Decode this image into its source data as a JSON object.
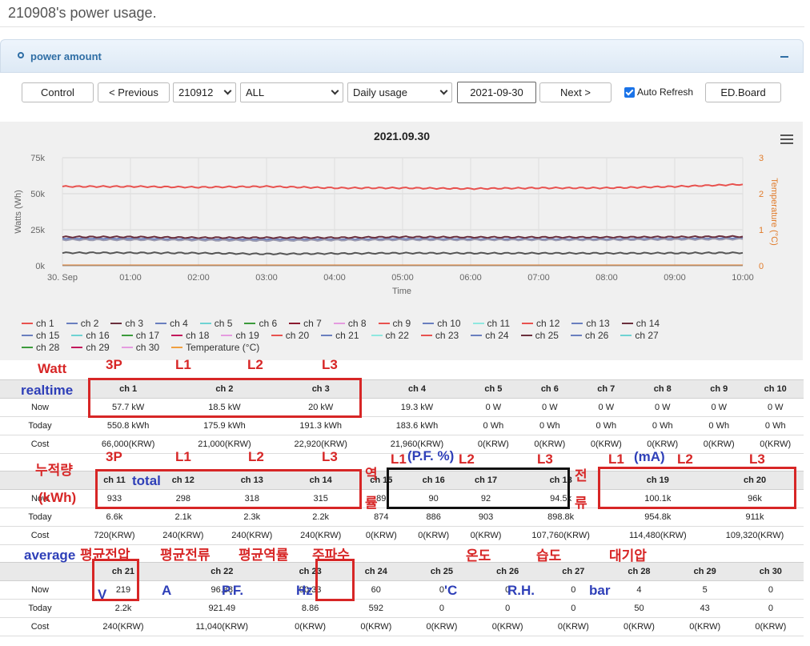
{
  "page": {
    "title": "210908's power usage."
  },
  "panel": {
    "title": "power amount"
  },
  "toolbar": {
    "control": "Control",
    "previous": "< Previous",
    "device": "210912",
    "channel": "ALL",
    "mode": "Daily usage",
    "date": "2021-09-30",
    "next": "Next >",
    "auto_refresh": "Auto Refresh",
    "edboard": "ED.Board"
  },
  "chart_data": {
    "type": "line",
    "title": "2021.09.30",
    "xlabel": "Time",
    "ylabel": "Watts (Wh)",
    "y2label": "Temperature (°C)",
    "x_ticks": [
      "30. Sep",
      "01:00",
      "02:00",
      "03:00",
      "04:00",
      "05:00",
      "06:00",
      "07:00",
      "08:00",
      "09:00",
      "10:00"
    ],
    "y_ticks": [
      "0k",
      "25k",
      "50k",
      "75k"
    ],
    "y2_ticks": [
      "0",
      "1",
      "2",
      "3"
    ],
    "ylim": [
      0,
      75000
    ],
    "y2lim": [
      0,
      3
    ],
    "grid": true,
    "series": [
      {
        "name": "ch 1",
        "color": "#e8524f",
        "values": [
          55000,
          55000,
          54500,
          55000,
          54000,
          54000,
          53500,
          54000,
          54000,
          55000,
          56500
        ]
      },
      {
        "name": "ch 2",
        "color": "#6a7fbf",
        "values": [
          19000,
          19000,
          18500,
          18500,
          18500,
          18800,
          18700,
          18600,
          18600,
          19000,
          19300
        ]
      },
      {
        "name": "ch 3",
        "color": "#6b2f3d",
        "values": [
          20000,
          20000,
          19500,
          19500,
          19500,
          20000,
          19800,
          19800,
          19800,
          20000,
          20300
        ]
      },
      {
        "name": "ch 4",
        "color": "#9a9ab0",
        "values": [
          18000,
          18000,
          17800,
          17500,
          17800,
          18000,
          18000,
          18000,
          18000,
          18300,
          18500
        ]
      },
      {
        "name": "ch 14",
        "color": "#555555",
        "values": [
          9000,
          9000,
          8800,
          8200,
          8500,
          8800,
          8700,
          8700,
          8700,
          8800,
          9000
        ]
      }
    ],
    "legend_position": "bottom"
  },
  "legend": {
    "rows": [
      [
        {
          "name": "ch 1",
          "color": "#e8524f"
        },
        {
          "name": "ch 2",
          "color": "#6a7fbf"
        },
        {
          "name": "ch 3",
          "color": "#6b2f3d"
        },
        {
          "name": "ch 4",
          "color": "#6a7fbf"
        },
        {
          "name": "ch 5",
          "color": "#6ed3d3"
        },
        {
          "name": "ch 6",
          "color": "#3b9a3b"
        },
        {
          "name": "ch 7",
          "color": "#8b1a2f"
        },
        {
          "name": "ch 8",
          "color": "#e59be0"
        },
        {
          "name": "ch 9",
          "color": "#e8524f"
        },
        {
          "name": "ch 10",
          "color": "#6a7fbf"
        },
        {
          "name": "ch 11",
          "color": "#8fe8e0"
        },
        {
          "name": "ch 12",
          "color": "#e8524f"
        },
        {
          "name": "ch 13",
          "color": "#6a7fbf"
        },
        {
          "name": "ch 14",
          "color": "#6b2f3d"
        }
      ],
      [
        {
          "name": "ch 15",
          "color": "#6a7fbf"
        },
        {
          "name": "ch 16",
          "color": "#6ed3d3"
        },
        {
          "name": "ch 17",
          "color": "#3b9a3b"
        },
        {
          "name": "ch 18",
          "color": "#c2185b"
        },
        {
          "name": "ch 19",
          "color": "#e59be0"
        },
        {
          "name": "ch 20",
          "color": "#e8524f"
        },
        {
          "name": "ch 21",
          "color": "#6a7fbf"
        },
        {
          "name": "ch 22",
          "color": "#8fe8e0"
        },
        {
          "name": "ch 23",
          "color": "#e8524f"
        },
        {
          "name": "ch 24",
          "color": "#6a7fbf"
        },
        {
          "name": "ch 25",
          "color": "#6b2f3d"
        },
        {
          "name": "ch 26",
          "color": "#6a7fbf"
        },
        {
          "name": "ch 27",
          "color": "#6ed3d3"
        }
      ],
      [
        {
          "name": "ch 28",
          "color": "#3b9a3b"
        },
        {
          "name": "ch 29",
          "color": "#c2185b"
        },
        {
          "name": "ch 30",
          "color": "#e59be0"
        },
        {
          "name": "Temperature (°C)",
          "color": "#f0a040"
        }
      ]
    ]
  },
  "tables": [
    {
      "headers": [
        "ch 1",
        "ch 2",
        "ch 3",
        "ch 4",
        "ch 5",
        "ch 6",
        "ch 7",
        "ch 8",
        "ch 9",
        "ch 10"
      ],
      "rows": [
        {
          "label": "Now",
          "cells": [
            "57.7 kW",
            "18.5 kW",
            "20 kW",
            "19.3 kW",
            "0 W",
            "0 W",
            "0 W",
            "0 W",
            "0 W",
            "0 W"
          ]
        },
        {
          "label": "Today",
          "cells": [
            "550.8 kWh",
            "175.9 kWh",
            "191.3 kWh",
            "183.6 kWh",
            "0 Wh",
            "0 Wh",
            "0 Wh",
            "0 Wh",
            "0 Wh",
            "0 Wh"
          ]
        },
        {
          "label": "Cost",
          "cells": [
            "66,000(KRW)",
            "21,000(KRW)",
            "22,920(KRW)",
            "21,960(KRW)",
            "0(KRW)",
            "0(KRW)",
            "0(KRW)",
            "0(KRW)",
            "0(KRW)",
            "0(KRW)"
          ]
        }
      ]
    },
    {
      "headers": [
        "ch 11",
        "ch 12",
        "ch 13",
        "ch 14",
        "ch 15",
        "ch 16",
        "ch 17",
        "ch 18",
        "ch 19",
        "ch 20"
      ],
      "rows": [
        {
          "label": "Now",
          "cells": [
            "933",
            "298",
            "318",
            "315",
            "89",
            "90",
            "92",
            "94.5k",
            "100.1k",
            "96k"
          ]
        },
        {
          "label": "Today",
          "cells": [
            "6.6k",
            "2.1k",
            "2.3k",
            "2.2k",
            "874",
            "886",
            "903",
            "898.8k",
            "954.8k",
            "911k"
          ]
        },
        {
          "label": "Cost",
          "cells": [
            "720(KRW)",
            "240(KRW)",
            "240(KRW)",
            "240(KRW)",
            "0(KRW)",
            "0(KRW)",
            "0(KRW)",
            "107,760(KRW)",
            "114,480(KRW)",
            "109,320(KRW)"
          ]
        }
      ]
    },
    {
      "headers": [
        "ch 21",
        "ch 22",
        "ch 23",
        "ch 24",
        "ch 25",
        "ch 26",
        "ch 27",
        "ch 28",
        "ch 29",
        "ch 30"
      ],
      "rows": [
        {
          "label": "Now",
          "cells": [
            "219",
            "96.88",
            "90.33",
            "60",
            "0",
            "0",
            "0",
            "4",
            "5",
            "0"
          ]
        },
        {
          "label": "Today",
          "cells": [
            "2.2k",
            "921.49",
            "8.86",
            "592",
            "0",
            "0",
            "0",
            "50",
            "43",
            "0"
          ]
        },
        {
          "label": "Cost",
          "cells": [
            "240(KRW)",
            "11,040(KRW)",
            "0(KRW)",
            "0(KRW)",
            "0(KRW)",
            "0(KRW)",
            "0(KRW)",
            "0(KRW)",
            "0(KRW)",
            "0(KRW)"
          ]
        }
      ]
    }
  ],
  "annotations": {
    "watt": "Watt",
    "realtime": "realtime",
    "p3_a": "3P",
    "l1_a": "L1",
    "l2_a": "L2",
    "l3_a": "L3",
    "cumulative": "누적량",
    "kwh": "(kWh)",
    "p3_b": "3P",
    "total": "total",
    "l1_b": "L1",
    "l2_b": "L2",
    "l3_b": "L3",
    "pf_label1": "역",
    "pf_label2": "률",
    "l1_c": "L1",
    "pf_pct": "(P.F. %)",
    "l2_c": "L2",
    "l3_c": "L3",
    "cur_label1": "전",
    "cur_label2": "류",
    "l1_d": "L1",
    "ma": "(mA)",
    "l2_d": "L2",
    "l3_d": "L3",
    "average": "average",
    "avg_voltage": "평균전압",
    "avg_current": "평균전류",
    "avg_pf": "평균역률",
    "frequency": "주파수",
    "temperature": "온도",
    "humidity": "습도",
    "pressure": "대기압",
    "v": "V",
    "a": "A",
    "pf": "P.F.",
    "hz": "Hz",
    "degc": "'C",
    "rh": "R.H.",
    "bar": "bar"
  }
}
